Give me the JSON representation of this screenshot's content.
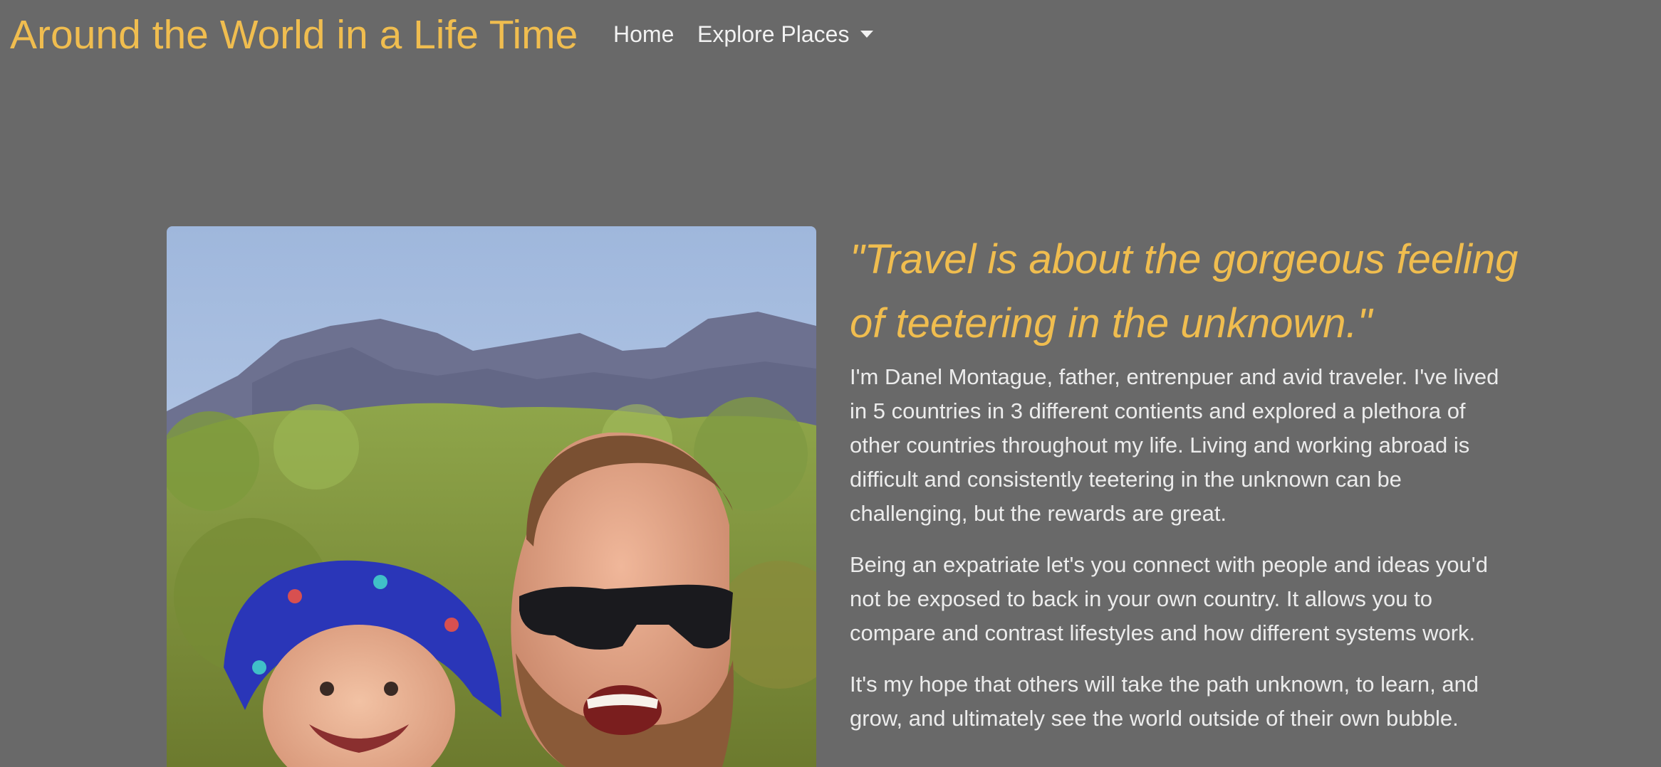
{
  "nav": {
    "brand": "Around the World in a Life Time",
    "home_label": "Home",
    "explore_label": "Explore Places",
    "explore_icon": "caret-down-icon"
  },
  "hero": {
    "photo_alt": "Father and toddler smiling outdoors in front of mountains",
    "quote": "\"Travel is about the gorgeous feeling of teetering in the unknown.\"",
    "paragraphs": [
      "I'm Danel Montague, father, entrenpuer and avid traveler. I've lived in 5 countries in 3 different contients and explored a plethora of other countries throughout my life. Living and working abroad is difficult and consistently teetering in the unknown can be challenging, but the rewards are great.",
      "Being an expatriate let's you connect with people and ideas you'd not be exposed to back in your own country. It allows you to compare and contrast lifestyles and how different systems work.",
      "It's my hope that others will take the path unknown, to learn, and grow, and ultimately see the world outside of their own bubble."
    ]
  },
  "colors": {
    "background": "#696969",
    "accent": "#f0bd4f",
    "text": "#ececec"
  }
}
